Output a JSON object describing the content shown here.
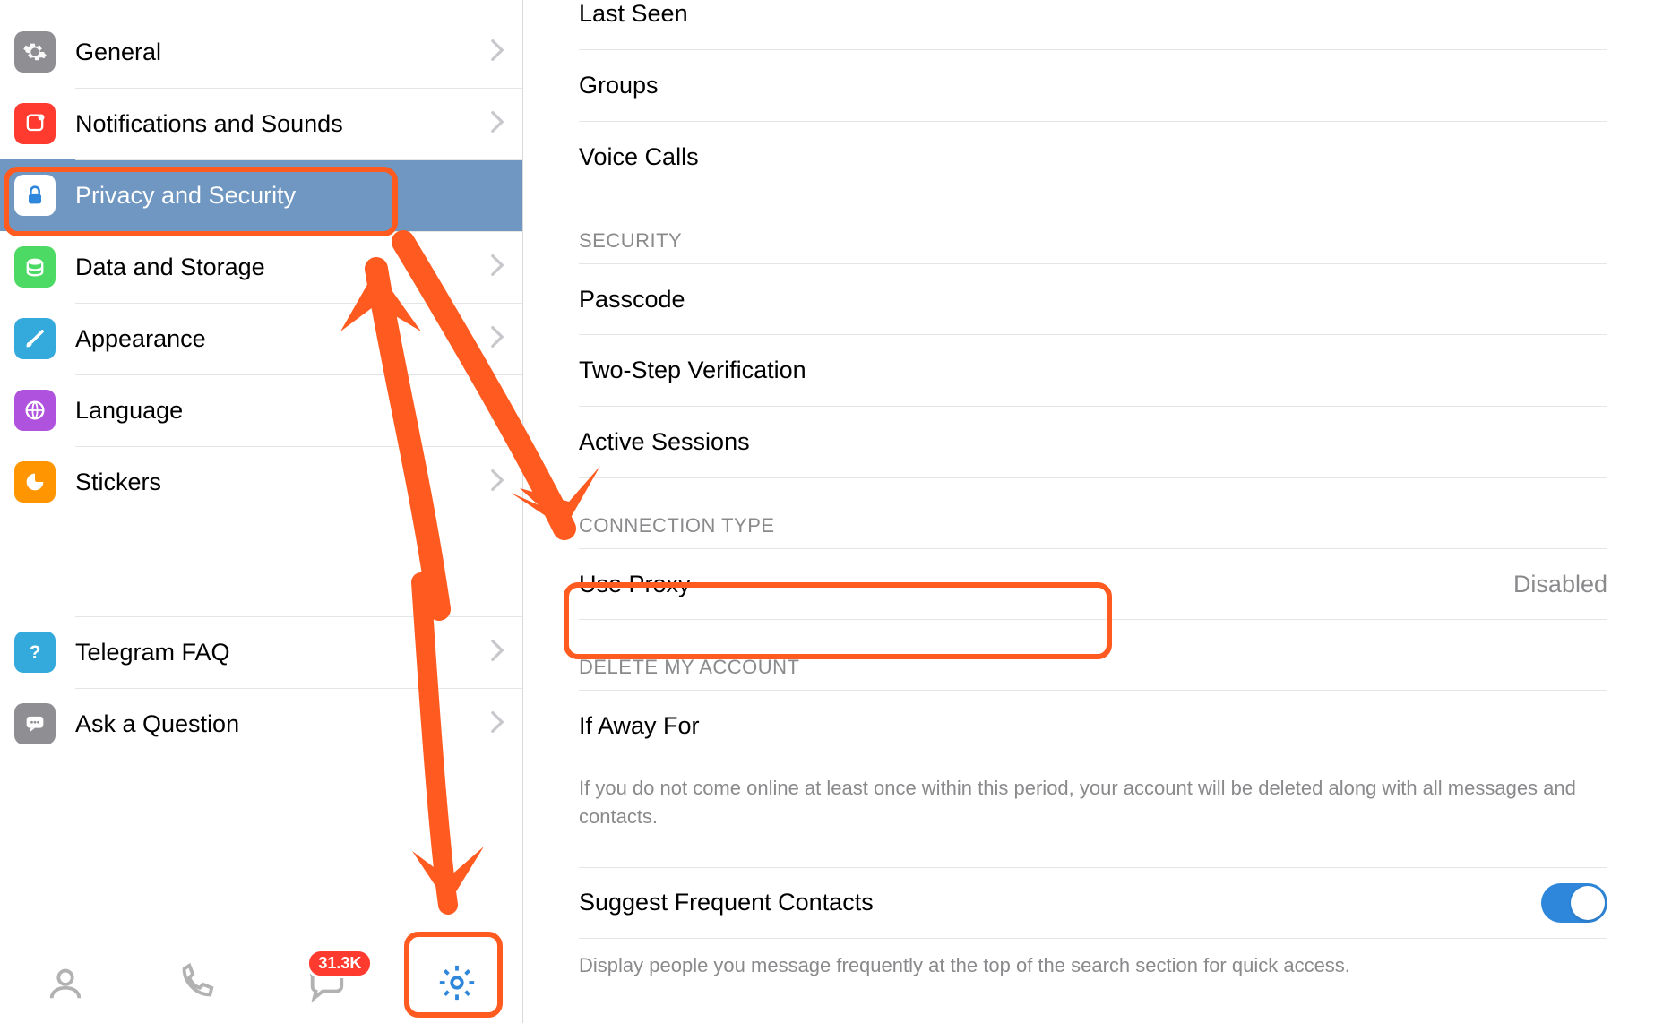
{
  "sidebar": {
    "items": [
      {
        "label": "General"
      },
      {
        "label": "Notifications and Sounds"
      },
      {
        "label": "Privacy and Security"
      },
      {
        "label": "Data and Storage"
      },
      {
        "label": "Appearance"
      },
      {
        "label": "Language"
      },
      {
        "label": "Stickers"
      }
    ],
    "help": [
      {
        "label": "Telegram FAQ"
      },
      {
        "label": "Ask a Question"
      }
    ]
  },
  "tabbar": {
    "badge": "31.3K"
  },
  "main": {
    "privacy_rows": [
      {
        "label": "Last Seen"
      },
      {
        "label": "Groups"
      },
      {
        "label": "Voice Calls"
      }
    ],
    "security_header": "SECURITY",
    "security_rows": [
      {
        "label": "Passcode"
      },
      {
        "label": "Two-Step Verification"
      },
      {
        "label": "Active Sessions"
      }
    ],
    "connection_header": "CONNECTION TYPE",
    "connection_row": {
      "label": "Use Proxy",
      "value": "Disabled"
    },
    "delete_header": "DELETE MY ACCOUNT",
    "delete_row": {
      "label": "If Away For"
    },
    "delete_footnote": "If you do not come online at least once within this period, your account will be deleted along with all messages and contacts.",
    "suggest_row": {
      "label": "Suggest Frequent Contacts"
    },
    "suggest_footnote": "Display people you message frequently at the top of the search section for quick access."
  },
  "annotations": {
    "highlight_sidebar": "Privacy and Security",
    "highlight_row": "Use Proxy",
    "highlight_tab": "Settings"
  }
}
